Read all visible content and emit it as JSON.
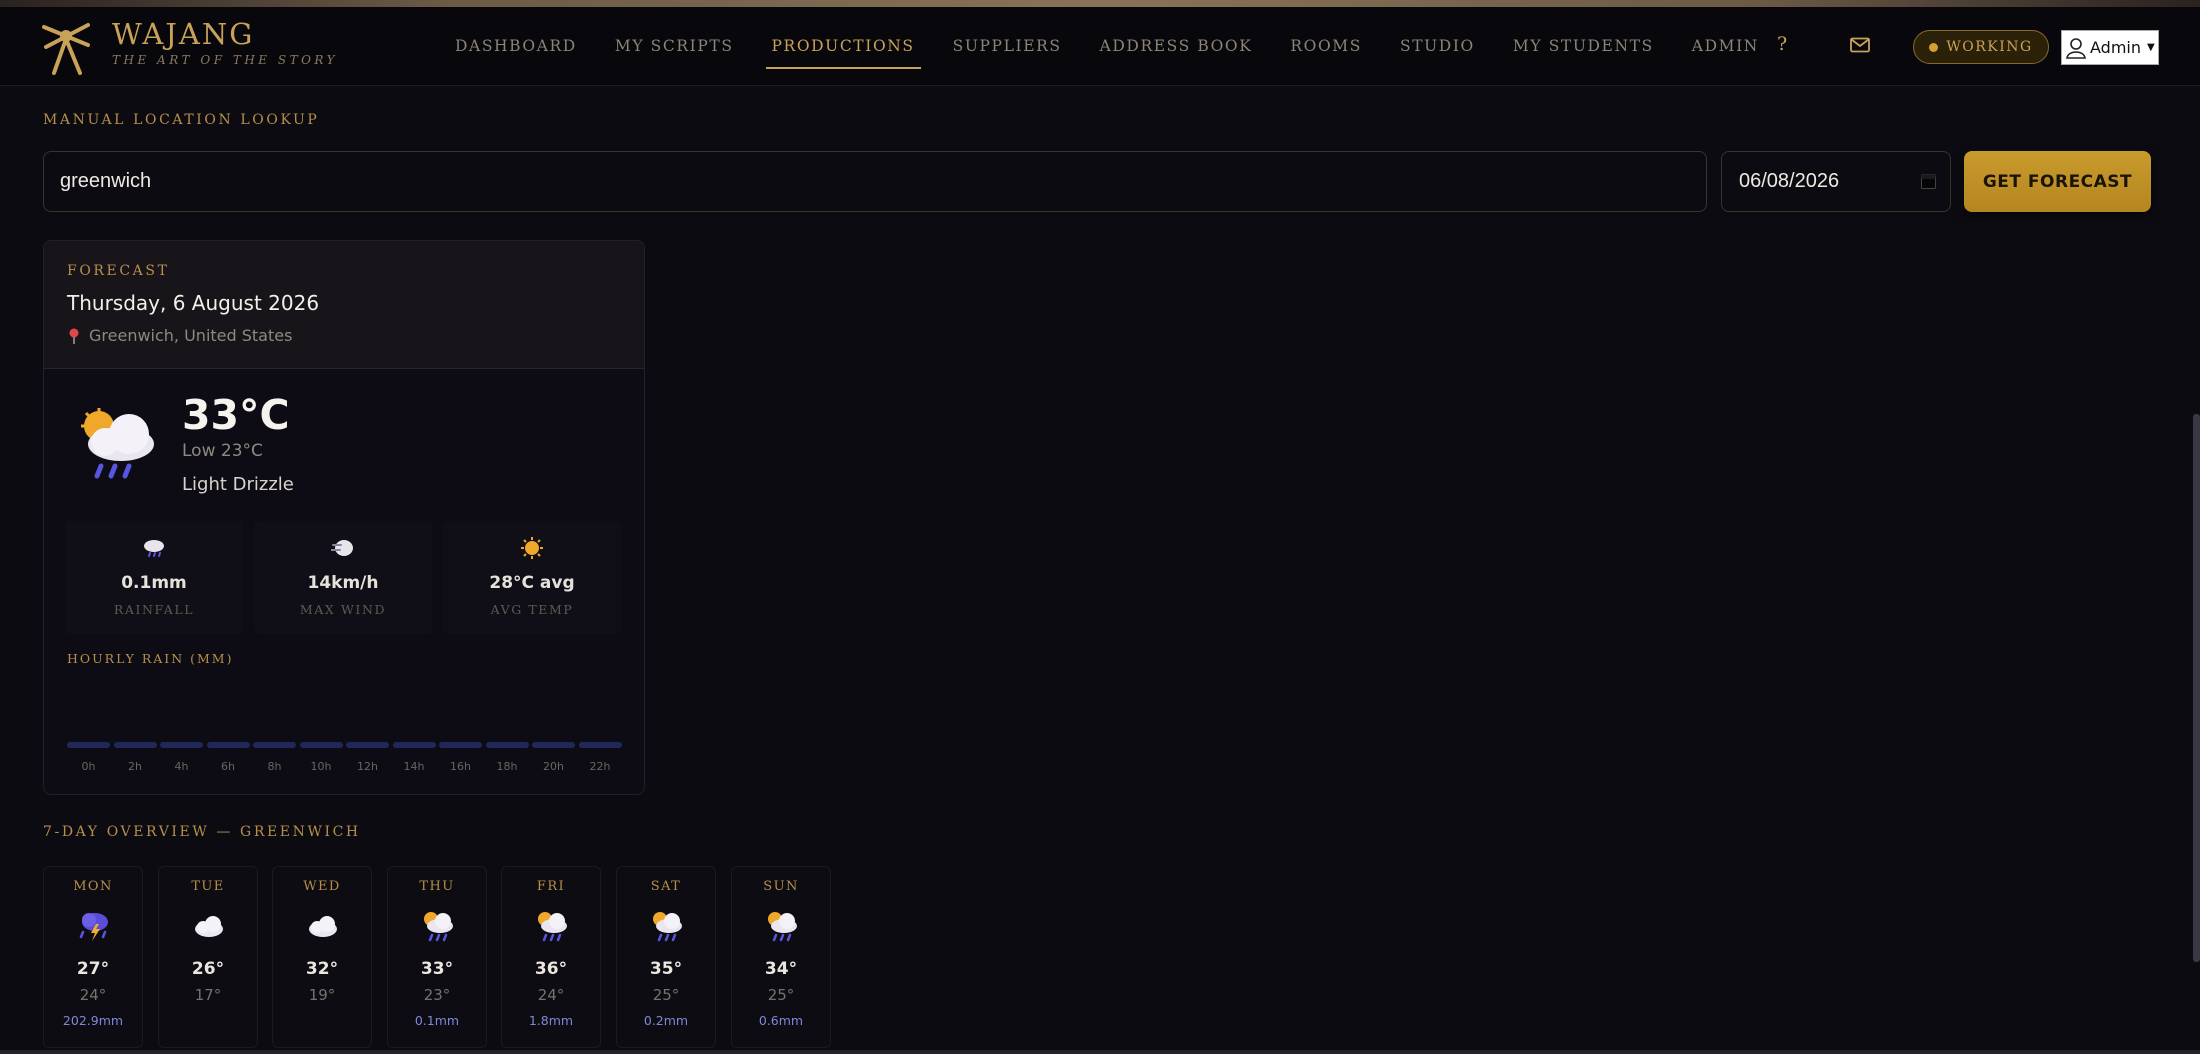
{
  "brand": {
    "name": "WAJANG",
    "tagline": "THE ART OF THE STORY"
  },
  "nav": {
    "items": [
      "DASHBOARD",
      "MY SCRIPTS",
      "PRODUCTIONS",
      "SUPPLIERS",
      "ADDRESS BOOK",
      "ROOMS",
      "STUDIO",
      "MY STUDENTS",
      "ADMIN"
    ],
    "active": "PRODUCTIONS",
    "help_label": "?",
    "status_label": "WORKING",
    "user_label": "Admin"
  },
  "lookup": {
    "section_label": "MANUAL LOCATION LOOKUP",
    "location_value": "greenwich",
    "date_value": "06/08/2026",
    "button_label": "GET FORECAST"
  },
  "forecast": {
    "label": "FORECAST",
    "date": "Thursday, 6 August 2026",
    "location": "Greenwich, United States",
    "temperature": "33°C",
    "low": "Low 23°C",
    "condition": "Light Drizzle",
    "condition_icon": "sun-cloud-rain-icon",
    "stats": [
      {
        "icon": "rain-cloud-icon",
        "value": "0.1mm",
        "label": "RAINFALL"
      },
      {
        "icon": "wind-icon",
        "value": "14km/h",
        "label": "MAX WIND"
      },
      {
        "icon": "sun-icon",
        "value": "28°C avg",
        "label": "AVG TEMP"
      }
    ],
    "hourly_label": "HOURLY RAIN (MM)",
    "hourly_hours": [
      "0h",
      "2h",
      "4h",
      "6h",
      "8h",
      "10h",
      "12h",
      "14h",
      "16h",
      "18h",
      "20h",
      "22h"
    ],
    "hourly_rain_mm": [
      0,
      0,
      0,
      0,
      0,
      0,
      0,
      0,
      0,
      0,
      0,
      0
    ]
  },
  "week": {
    "label": "7-DAY OVERVIEW — GREENWICH",
    "days": [
      {
        "name": "MON",
        "icon": "thunderstorm-icon",
        "high": "27°",
        "low": "24°",
        "rain": "202.9mm"
      },
      {
        "name": "TUE",
        "icon": "cloud-icon",
        "high": "26°",
        "low": "17°",
        "rain": ""
      },
      {
        "name": "WED",
        "icon": "cloud-icon",
        "high": "32°",
        "low": "19°",
        "rain": ""
      },
      {
        "name": "THU",
        "icon": "sun-cloud-rain-icon",
        "high": "33°",
        "low": "23°",
        "rain": "0.1mm"
      },
      {
        "name": "FRI",
        "icon": "sun-cloud-rain-icon",
        "high": "36°",
        "low": "24°",
        "rain": "1.8mm"
      },
      {
        "name": "SAT",
        "icon": "sun-cloud-rain-icon",
        "high": "35°",
        "low": "25°",
        "rain": "0.2mm"
      },
      {
        "name": "SUN",
        "icon": "sun-cloud-rain-icon",
        "high": "34°",
        "low": "25°",
        "rain": "0.6mm"
      }
    ]
  },
  "colors": {
    "accent": "#c9a25a",
    "button": "#c99a2c",
    "rain": "#7f88d8",
    "background": "#0c0b12"
  }
}
